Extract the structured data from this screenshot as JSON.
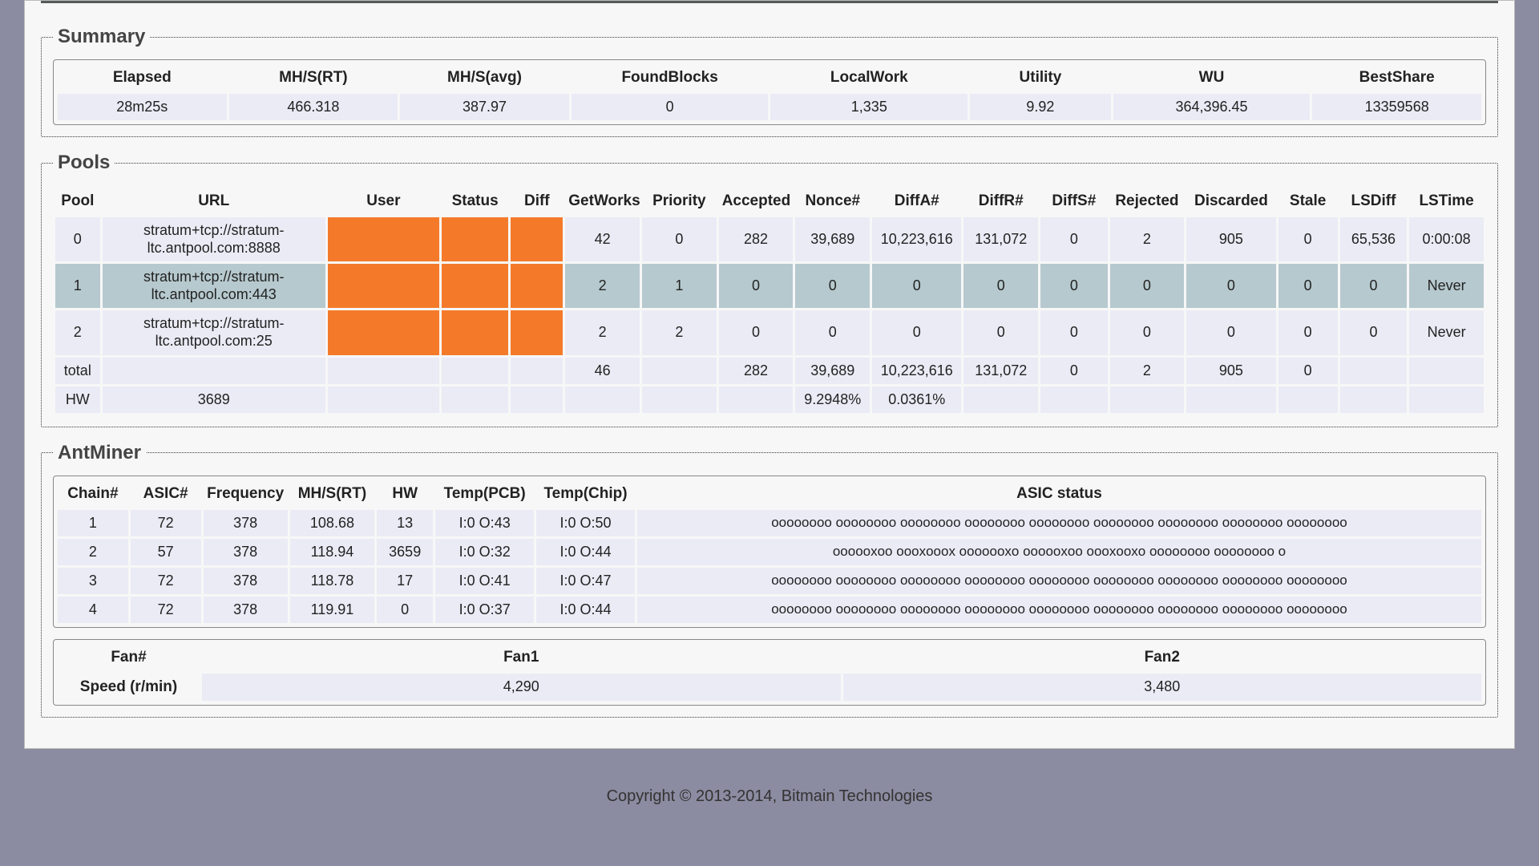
{
  "sections": {
    "summary_title": "Summary",
    "pools_title": "Pools",
    "antminer_title": "AntMiner"
  },
  "summary": {
    "headers": [
      "Elapsed",
      "MH/S(RT)",
      "MH/S(avg)",
      "FoundBlocks",
      "LocalWork",
      "Utility",
      "WU",
      "BestShare"
    ],
    "row": [
      "28m25s",
      "466.318",
      "387.97",
      "0",
      "1,335",
      "9.92",
      "364,396.45",
      "13359568"
    ]
  },
  "pools": {
    "headers": [
      "Pool",
      "URL",
      "User",
      "Status",
      "Diff",
      "GetWorks",
      "Priority",
      "Accepted",
      "Nonce#",
      "DiffA#",
      "DiffR#",
      "DiffS#",
      "Rejected",
      "Discarded",
      "Stale",
      "LSDiff",
      "LSTime"
    ],
    "rows": [
      {
        "pool": "0",
        "url": "stratum+tcp://stratum-ltc.antpool.com:8888",
        "user": "",
        "status": "",
        "diff": "",
        "getworks": "42",
        "priority": "0",
        "accepted": "282",
        "nonce": "39,689",
        "diffa": "10,223,616",
        "diffr": "131,072",
        "diffs": "0",
        "rejected": "2",
        "discarded": "905",
        "stale": "0",
        "lsdiff": "65,536",
        "lstime": "0:00:08",
        "alt": false
      },
      {
        "pool": "1",
        "url": "stratum+tcp://stratum-ltc.antpool.com:443",
        "user": "",
        "status": "",
        "diff": "",
        "getworks": "2",
        "priority": "1",
        "accepted": "0",
        "nonce": "0",
        "diffa": "0",
        "diffr": "0",
        "diffs": "0",
        "rejected": "0",
        "discarded": "0",
        "stale": "0",
        "lsdiff": "0",
        "lstime": "Never",
        "alt": true
      },
      {
        "pool": "2",
        "url": "stratum+tcp://stratum-ltc.antpool.com:25",
        "user": "",
        "status": "",
        "diff": "",
        "getworks": "2",
        "priority": "2",
        "accepted": "0",
        "nonce": "0",
        "diffa": "0",
        "diffr": "0",
        "diffs": "0",
        "rejected": "0",
        "discarded": "0",
        "stale": "0",
        "lsdiff": "0",
        "lstime": "Never",
        "alt": false
      }
    ],
    "total_label": "total",
    "total": {
      "getworks": "46",
      "accepted": "282",
      "nonce": "39,689",
      "diffa": "10,223,616",
      "diffr": "131,072",
      "diffs": "0",
      "rejected": "2",
      "discarded": "905",
      "stale": "0"
    },
    "hw_label": "HW",
    "hw": {
      "url": "3689",
      "nonce": "9.2948%",
      "diffa": "0.0361%"
    }
  },
  "antminer": {
    "chain_headers": [
      "Chain#",
      "ASIC#",
      "Frequency",
      "MH/S(RT)",
      "HW",
      "Temp(PCB)",
      "Temp(Chip)",
      "ASIC status"
    ],
    "chains": [
      {
        "n": "1",
        "asic": "72",
        "freq": "378",
        "mhs": "108.68",
        "hw": "13",
        "pcb": "I:0 O:43",
        "chip": "I:0 O:50",
        "status": "oooooooo oooooooo oooooooo oooooooo oooooooo oooooooo oooooooo oooooooo oooooooo"
      },
      {
        "n": "2",
        "asic": "57",
        "freq": "378",
        "mhs": "118.94",
        "hw": "3659",
        "pcb": "I:0 O:32",
        "chip": "I:0 O:44",
        "status": "oooooxoo oooxooox ooooooxo oooooxoo oooxooxo oooooooo oooooooo o"
      },
      {
        "n": "3",
        "asic": "72",
        "freq": "378",
        "mhs": "118.78",
        "hw": "17",
        "pcb": "I:0 O:41",
        "chip": "I:0 O:47",
        "status": "oooooooo oooooooo oooooooo oooooooo oooooooo oooooooo oooooooo oooooooo oooooooo"
      },
      {
        "n": "4",
        "asic": "72",
        "freq": "378",
        "mhs": "119.91",
        "hw": "0",
        "pcb": "I:0 O:37",
        "chip": "I:0 O:44",
        "status": "oooooooo oooooooo oooooooo oooooooo oooooooo oooooooo oooooooo oooooooo oooooooo"
      }
    ],
    "fan_headers": [
      "Fan#",
      "Fan1",
      "Fan2"
    ],
    "fan_row_label": "Speed (r/min)",
    "fan_row": [
      "4,290",
      "3,480"
    ]
  },
  "footer": "Copyright © 2013-2014, Bitmain Technologies"
}
